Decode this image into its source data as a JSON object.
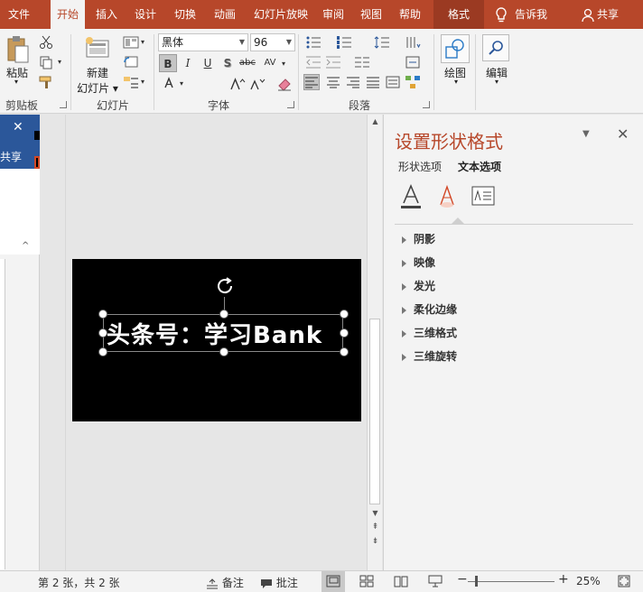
{
  "menu": {
    "tabs": [
      "文件",
      "开始",
      "插入",
      "设计",
      "切换",
      "动画",
      "幻灯片放映",
      "审阅",
      "视图",
      "帮助",
      "格式"
    ],
    "tell_me": "告诉我",
    "share": "共享"
  },
  "ribbon": {
    "clipboard": {
      "paste": "粘贴",
      "label": "剪贴板"
    },
    "slides": {
      "new_slide_line1": "新建",
      "new_slide_line2": "幻灯片",
      "label": "幻灯片"
    },
    "font": {
      "font_name": "黑体",
      "font_size": "96",
      "bold": "B",
      "italic": "I",
      "underline": "U",
      "shadow": "S",
      "strike": "abc",
      "spacing": "AV",
      "label": "字体"
    },
    "paragraph": {
      "label": "段落"
    },
    "drawing": {
      "label": "绘图"
    },
    "editing": {
      "label": "编辑"
    }
  },
  "left_panel": {
    "share_text": "共享"
  },
  "slide": {
    "text": "头条号：学习Bank"
  },
  "pane": {
    "title": "设置形状格式",
    "tab_shape": "形状选项",
    "tab_text": "文本选项",
    "sections": [
      "阴影",
      "映像",
      "发光",
      "柔化边缘",
      "三维格式",
      "三维旋转"
    ]
  },
  "status": {
    "slide_info": "第 2 张，共 2 张",
    "notes": "备注",
    "comments": "批注",
    "zoom": "25%"
  },
  "colors": {
    "accent": "#b7472a",
    "notif": "#2b579a"
  }
}
